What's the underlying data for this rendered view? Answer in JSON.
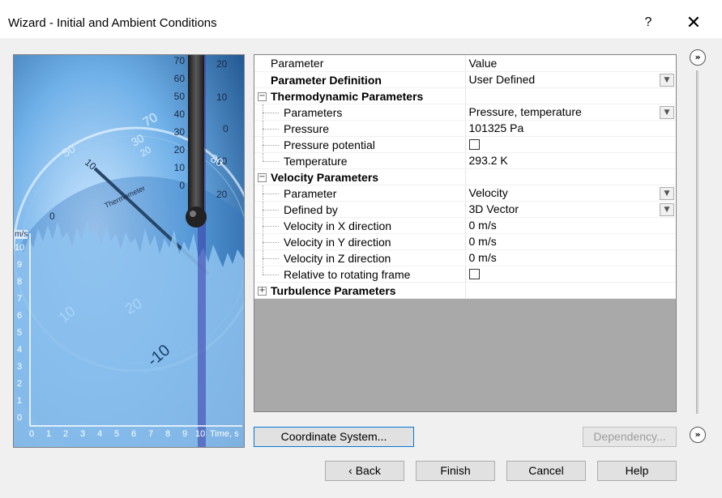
{
  "window": {
    "title": "Wizard - Initial and Ambient Conditions",
    "help_glyph": "?",
    "close_glyph": "✕"
  },
  "grid": {
    "header": {
      "param": "Parameter",
      "value": "Value"
    },
    "rows": [
      {
        "label": "Parameter Definition",
        "value": "User Defined"
      },
      {
        "label": "Thermodynamic Parameters",
        "expander": "−"
      },
      {
        "label": "Parameters",
        "value": "Pressure, temperature"
      },
      {
        "label": "Pressure",
        "value": "101325 Pa"
      },
      {
        "label": "Pressure potential"
      },
      {
        "label": "Temperature",
        "value": "293.2 K"
      },
      {
        "label": "Velocity Parameters",
        "expander": "−"
      },
      {
        "label": "Parameter",
        "value": "Velocity"
      },
      {
        "label": "Defined by",
        "value": "3D Vector"
      },
      {
        "label": "Velocity in X direction",
        "value": "0 m/s"
      },
      {
        "label": "Velocity in Y direction",
        "value": "0 m/s"
      },
      {
        "label": "Velocity in Z direction",
        "value": "0 m/s"
      },
      {
        "label": "Relative to rotating frame"
      },
      {
        "label": "Turbulence Parameters",
        "expander": "+"
      }
    ]
  },
  "picture": {
    "thermo_left_ticks": [
      "70",
      "60",
      "50",
      "40",
      "30",
      "20",
      "10",
      "0"
    ],
    "thermo_right_ticks": [
      "20",
      "10",
      "0",
      "10",
      "20"
    ],
    "dial_text": [
      "50",
      "70",
      "30",
      "20",
      "10",
      "0",
      "Thermometer",
      "20",
      "10",
      "-10",
      "80"
    ],
    "y_axis_label": "m/s",
    "y_ticks": [
      "10",
      "9",
      "8",
      "7",
      "6",
      "5",
      "4",
      "3",
      "2",
      "1",
      "0"
    ],
    "x_ticks": [
      "0",
      "1",
      "2",
      "3",
      "4",
      "5",
      "6",
      "7",
      "8",
      "9",
      "10"
    ],
    "x_axis_label": "Time, s"
  },
  "buttons": {
    "coordinate_system": "Coordinate System...",
    "dependency": "Dependency...",
    "back": "Back",
    "back_glyph": "‹",
    "finish": "Finish",
    "cancel": "Cancel",
    "help": "Help",
    "expand_glyph": "»"
  }
}
